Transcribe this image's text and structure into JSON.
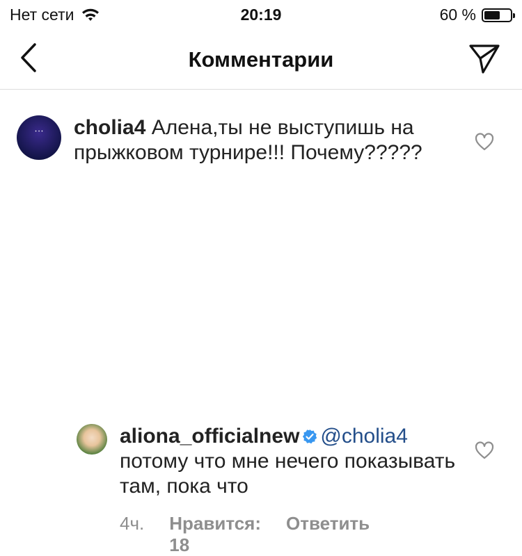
{
  "status_bar": {
    "carrier": "Нет сети",
    "time": "20:19",
    "battery_percent_text": "60 %",
    "battery_level": 0.6
  },
  "nav": {
    "title": "Комментарии",
    "back_icon": "chevron-left-icon",
    "send_icon": "paper-plane-icon"
  },
  "comments": [
    {
      "username": "cholia4",
      "text": "Алена,ты не выступишь на прыжковом турнире!!! Почему?????"
    },
    {
      "username": "aliona_officialnew",
      "verified": true,
      "mention": "@cholia4",
      "text": "потому что мне нечего показывать там, пока что",
      "time": "4ч.",
      "likes": "Нравится: 18",
      "reply": "Ответить"
    }
  ],
  "colors": {
    "mention": "#234e8a",
    "verified": "#3897f0",
    "meta": "#8e8e8e"
  }
}
